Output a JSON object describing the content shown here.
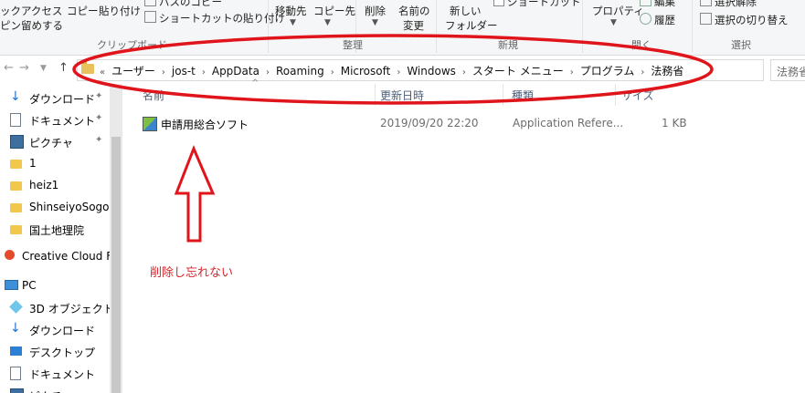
{
  "ribbon": {
    "quick_access": "ックアクセス",
    "pin_to": "ピン留めする",
    "copy": "コピー",
    "paste": "貼り付け",
    "copy_path": "パスのコピー",
    "paste_shortcut": "ショートカットの貼り付け",
    "move_to": "移動先",
    "copy_to": "コピー先",
    "delete": "削除",
    "rename_line1": "名前の",
    "rename_line2": "変更",
    "new_folder_line1": "新しい",
    "new_folder_line2": "フォルダー",
    "shortcut": "ショートカット",
    "properties": "プロパティ",
    "edit": "編集",
    "history": "履歴",
    "select_none": "選択解除",
    "invert_selection": "選択の切り替え",
    "group_clipboard": "クリップボード",
    "group_organize": "整理",
    "group_new": "新規",
    "group_open": "開く",
    "group_select": "選択"
  },
  "nav": {
    "back": "←",
    "forward": "→",
    "up": "↑",
    "refresh": "↻"
  },
  "address": {
    "overflow": "«",
    "segments": [
      "ユーザー",
      "jos-t",
      "AppData",
      "Roaming",
      "Microsoft",
      "Windows",
      "スタート メニュー",
      "プログラム",
      "法務省"
    ]
  },
  "search": {
    "placeholder": "法務省"
  },
  "sidebar": {
    "items": [
      {
        "label": "ダウンロード",
        "icon": "download-icon",
        "pinned": true
      },
      {
        "label": "ドキュメント",
        "icon": "document-icon",
        "pinned": true
      },
      {
        "label": "ピクチャ",
        "icon": "picture-icon",
        "pinned": true
      },
      {
        "label": "1",
        "icon": "folder-icon"
      },
      {
        "label": "heiz1",
        "icon": "folder-icon"
      },
      {
        "label": "ShinseiyoSogoSo",
        "icon": "folder-icon"
      },
      {
        "label": "国土地理院",
        "icon": "folder-icon"
      },
      {
        "label": "Creative Cloud File",
        "icon": "creative-cloud-icon"
      },
      {
        "label": "PC",
        "icon": "pc-icon"
      },
      {
        "label": "3D オブジェクト",
        "icon": "3d-objects-icon"
      },
      {
        "label": "ダウンロード",
        "icon": "download-icon"
      },
      {
        "label": "デスクトップ",
        "icon": "desktop-icon"
      },
      {
        "label": "ドキュメント",
        "icon": "document-icon"
      },
      {
        "label": "ピクチャ",
        "icon": "picture-icon"
      }
    ]
  },
  "columns": [
    "名前",
    "更新日時",
    "種類",
    "サイズ"
  ],
  "files": [
    {
      "name": "申請用総合ソフト",
      "modified": "2019/09/20 22:20",
      "type": "Application Refere...",
      "size": "1 KB"
    }
  ],
  "annotation": {
    "note": "削除し忘れない",
    "color": "#d8262b"
  }
}
